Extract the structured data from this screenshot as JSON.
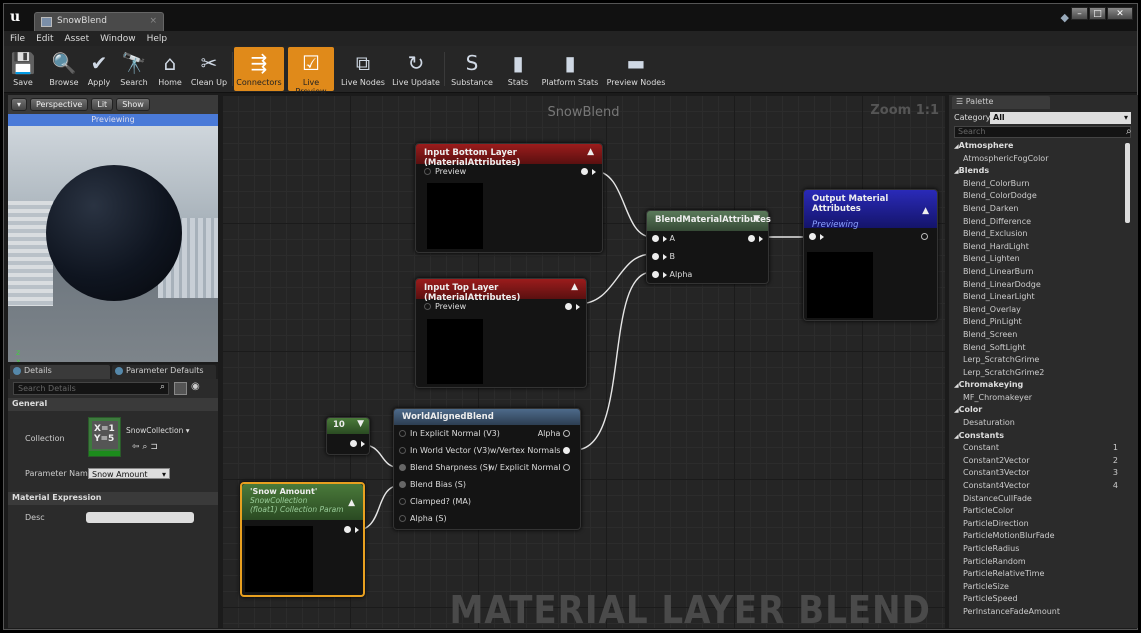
{
  "window": {
    "tab_title": "SnowBlend",
    "tab_close": "×",
    "controls": [
      "–",
      "□",
      "✕"
    ]
  },
  "menu": [
    "File",
    "Edit",
    "Asset",
    "Window",
    "Help"
  ],
  "toolbar": [
    {
      "label": "Save",
      "icon": "💾",
      "on": false
    },
    {
      "label": "Browse",
      "icon": "🔍",
      "on": false
    },
    {
      "label": "Apply",
      "icon": "✔",
      "on": false
    },
    {
      "label": "Search",
      "icon": "🔭",
      "on": false
    },
    {
      "label": "Home",
      "icon": "⌂",
      "on": false
    },
    {
      "label": "Clean Up",
      "icon": "✂",
      "on": false
    },
    {
      "label": "Connectors",
      "icon": "⇶",
      "on": true
    },
    {
      "label": "Live Preview",
      "icon": "☑",
      "on": true
    },
    {
      "label": "Live Nodes",
      "icon": "⧉",
      "on": false
    },
    {
      "label": "Live Update",
      "icon": "↻",
      "on": false
    },
    {
      "label": "Substance",
      "icon": "S",
      "on": false
    },
    {
      "label": "Stats",
      "icon": "▮",
      "on": false
    },
    {
      "label": "Platform Stats",
      "icon": "▮",
      "on": false
    },
    {
      "label": "Preview Nodes",
      "icon": "▬",
      "on": false
    }
  ],
  "viewport": {
    "perspective": "Perspective",
    "lit": "Lit",
    "show": "Show",
    "status": "Previewing",
    "axis_z": "z",
    "axis_x": "x"
  },
  "details": {
    "tab1": "Details",
    "tab2": "Parameter Defaults",
    "search_placeholder": "Search Details",
    "section_general": "General",
    "collection_label": "Collection",
    "collection_value": "SnowCollection",
    "thumb_text": "X=1 Y=5",
    "param_label": "Parameter Name",
    "param_value": "Snow Amount",
    "section_expression": "Material Expression",
    "desc_label": "Desc"
  },
  "graph": {
    "title": "SnowBlend",
    "zoom": "Zoom 1:1",
    "watermark": "MATERIAL LAYER BLEND",
    "nodes": {
      "bottom": {
        "title": "Input Bottom Layer (MaterialAttributes)",
        "pin": "Preview"
      },
      "top": {
        "title": "Input Top Layer (MaterialAttributes)",
        "pin": "Preview"
      },
      "blend": {
        "title": "BlendMaterialAttributes",
        "pins": [
          "A",
          "B",
          "Alpha"
        ]
      },
      "output": {
        "title": "Output Material Attributes",
        "status": "Previewing"
      },
      "const": {
        "value": "10"
      },
      "wab": {
        "title": "WorldAlignedBlend",
        "inputs": [
          "In Explicit Normal (V3)",
          "In World Vector (V3)",
          "Blend Sharpness (S)",
          "Blend Bias (S)",
          "Clamped? (MA)",
          "Alpha (S)"
        ],
        "outputs": [
          "Alpha",
          "w/Vertex Normals",
          "w/ Explicit Normal"
        ]
      },
      "snow": {
        "title": "'Snow Amount'",
        "sub1": "SnowCollection",
        "sub2": "(float1) Collection Param"
      }
    }
  },
  "palette": {
    "tab": "Palette",
    "category_label": "Category:",
    "category_value": "All",
    "search_placeholder": "Search",
    "items": [
      {
        "t": "cat",
        "l": "Atmosphere"
      },
      {
        "t": "item",
        "l": "AtmosphericFogColor"
      },
      {
        "t": "cat",
        "l": "Blends"
      },
      {
        "t": "item",
        "l": "Blend_ColorBurn"
      },
      {
        "t": "item",
        "l": "Blend_ColorDodge"
      },
      {
        "t": "item",
        "l": "Blend_Darken"
      },
      {
        "t": "item",
        "l": "Blend_Difference"
      },
      {
        "t": "item",
        "l": "Blend_Exclusion"
      },
      {
        "t": "item",
        "l": "Blend_HardLight"
      },
      {
        "t": "item",
        "l": "Blend_Lighten"
      },
      {
        "t": "item",
        "l": "Blend_LinearBurn"
      },
      {
        "t": "item",
        "l": "Blend_LinearDodge"
      },
      {
        "t": "item",
        "l": "Blend_LinearLight"
      },
      {
        "t": "item",
        "l": "Blend_Overlay"
      },
      {
        "t": "item",
        "l": "Blend_PinLight"
      },
      {
        "t": "item",
        "l": "Blend_Screen"
      },
      {
        "t": "item",
        "l": "Blend_SoftLight"
      },
      {
        "t": "item",
        "l": "Lerp_ScratchGrime"
      },
      {
        "t": "item",
        "l": "Lerp_ScratchGrime2"
      },
      {
        "t": "cat",
        "l": "Chromakeying"
      },
      {
        "t": "item",
        "l": "MF_Chromakeyer"
      },
      {
        "t": "cat",
        "l": "Color"
      },
      {
        "t": "item",
        "l": "Desaturation"
      },
      {
        "t": "cat",
        "l": "Constants"
      },
      {
        "t": "item",
        "l": "Constant",
        "n": "1"
      },
      {
        "t": "item",
        "l": "Constant2Vector",
        "n": "2"
      },
      {
        "t": "item",
        "l": "Constant3Vector",
        "n": "3"
      },
      {
        "t": "item",
        "l": "Constant4Vector",
        "n": "4"
      },
      {
        "t": "item",
        "l": "DistanceCullFade"
      },
      {
        "t": "item",
        "l": "ParticleColor"
      },
      {
        "t": "item",
        "l": "ParticleDirection"
      },
      {
        "t": "item",
        "l": "ParticleMotionBlurFade"
      },
      {
        "t": "item",
        "l": "ParticleRadius"
      },
      {
        "t": "item",
        "l": "ParticleRandom"
      },
      {
        "t": "item",
        "l": "ParticleRelativeTime"
      },
      {
        "t": "item",
        "l": "ParticleSize"
      },
      {
        "t": "item",
        "l": "ParticleSpeed"
      },
      {
        "t": "item",
        "l": "PerInstanceFadeAmount"
      }
    ]
  }
}
